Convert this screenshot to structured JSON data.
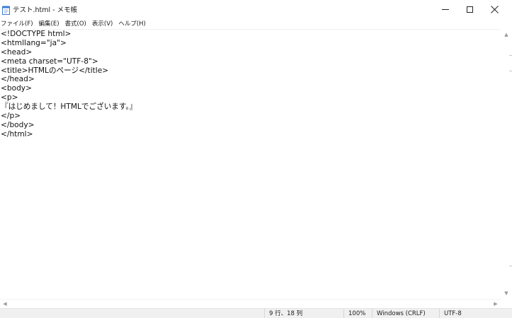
{
  "window": {
    "title": "テスト.html - メモ帳"
  },
  "icons": {
    "app": "notepad-icon",
    "minimize": "minimize-icon",
    "maximize": "maximize-icon",
    "close": "close-icon"
  },
  "menu": {
    "items": [
      {
        "label": "ファイル(F)"
      },
      {
        "label": "編集(E)"
      },
      {
        "label": "書式(O)"
      },
      {
        "label": "表示(V)"
      },
      {
        "label": "ヘルプ(H)"
      }
    ]
  },
  "editor": {
    "lines": [
      "<!DOCTYPE html>",
      "<htmllang=\"ja\">",
      "<head>",
      "<meta charset=\"UTF-8\">",
      "<title>HTMLのページ</title>",
      "</head>",
      "<body>",
      "<p>",
      "『はじめまして！HTMLでございます。』",
      "</p>",
      "</body>",
      "</html>"
    ]
  },
  "status": {
    "position": "9 行、18 列",
    "zoom": "100%",
    "line_ending": "Windows (CRLF)",
    "encoding": "UTF-8"
  },
  "colors": {
    "status_bar_bg": "#f0f0f0",
    "text": "#111111",
    "icon_blue": "#3a7bd5"
  }
}
